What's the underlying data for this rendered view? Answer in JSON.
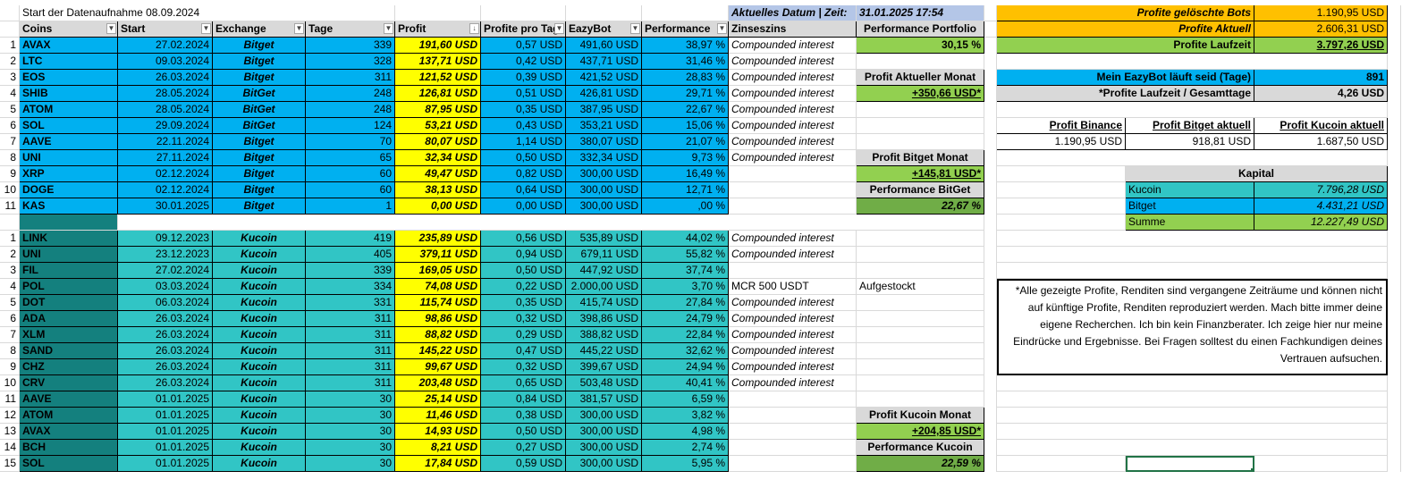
{
  "title_start": "Start der Datenaufnahme 08.09.2024",
  "date": {
    "label": "Aktuelles Datum | Zeit:",
    "value": "31.01.2025 17:54"
  },
  "headers": {
    "coins": "Coins",
    "start": "Start",
    "exchange": "Exchange",
    "tage": "Tage",
    "profit": "Profit",
    "profit_tag": "Profite pro Tag*",
    "eazybot": "EazyBot",
    "performance": "Performance",
    "zinseszins": "Zinseszins"
  },
  "group1": [
    {
      "n": "1",
      "coin": "AVAX",
      "start": "27.02.2024",
      "ex": "Bitget",
      "tage": "339",
      "profit": "191,60 USD",
      "ptag": "0,57 USD",
      "bot": "491,60 USD",
      "perf": "38,97 %",
      "zins": "Compounded interest"
    },
    {
      "n": "2",
      "coin": "LTC",
      "start": "09.03.2024",
      "ex": "Bitget",
      "tage": "328",
      "profit": "137,71 USD",
      "ptag": "0,42 USD",
      "bot": "437,71 USD",
      "perf": "31,46 %",
      "zins": "Compounded interest"
    },
    {
      "n": "3",
      "coin": "EOS",
      "start": "26.03.2024",
      "ex": "Bitget",
      "tage": "311",
      "profit": "121,52 USD",
      "ptag": "0,39 USD",
      "bot": "421,52 USD",
      "perf": "28,83 %",
      "zins": "Compounded interest"
    },
    {
      "n": "4",
      "coin": "SHIB",
      "start": "28.05.2024",
      "ex": "BitGet",
      "tage": "248",
      "profit": "126,81 USD",
      "ptag": "0,51 USD",
      "bot": "426,81 USD",
      "perf": "29,71 %",
      "zins": "Compounded interest"
    },
    {
      "n": "5",
      "coin": "ATOM",
      "start": "28.05.2024",
      "ex": "BitGet",
      "tage": "248",
      "profit": "87,95 USD",
      "ptag": "0,35 USD",
      "bot": "387,95 USD",
      "perf": "22,67 %",
      "zins": "Compounded interest"
    },
    {
      "n": "6",
      "coin": "SOL",
      "start": "29.09.2024",
      "ex": "BitGet",
      "tage": "124",
      "profit": "53,21 USD",
      "ptag": "0,43 USD",
      "bot": "353,21 USD",
      "perf": "15,06 %",
      "zins": "Compounded interest"
    },
    {
      "n": "7",
      "coin": "AAVE",
      "start": "22.11.2024",
      "ex": "Bitget",
      "tage": "70",
      "profit": "80,07 USD",
      "ptag": "1,14 USD",
      "bot": "380,07 USD",
      "perf": "21,07 %",
      "zins": "Compounded interest"
    },
    {
      "n": "8",
      "coin": "UNI",
      "start": "27.11.2024",
      "ex": "Bitget",
      "tage": "65",
      "profit": "32,34 USD",
      "ptag": "0,50 USD",
      "bot": "332,34 USD",
      "perf": "9,73 %",
      "zins": "Compounded interest"
    },
    {
      "n": "9",
      "coin": "XRP",
      "start": "02.12.2024",
      "ex": "Bitget",
      "tage": "60",
      "profit": "49,47 USD",
      "ptag": "0,82 USD",
      "bot": "300,00 USD",
      "perf": "16,49 %",
      "zins": ""
    },
    {
      "n": "10",
      "coin": "DOGE",
      "start": "02.12.2024",
      "ex": "Bitget",
      "tage": "60",
      "profit": "38,13 USD",
      "ptag": "0,64 USD",
      "bot": "300,00 USD",
      "perf": "12,71 %",
      "zins": ""
    },
    {
      "n": "11",
      "coin": "KAS",
      "start": "30.01.2025",
      "ex": "Bitget",
      "tage": "1",
      "profit": "0,00 USD",
      "ptag": "0,00 USD",
      "bot": "300,00 USD",
      "perf": ",00 %",
      "zins": ""
    }
  ],
  "group2": [
    {
      "n": "1",
      "coin": "LINK",
      "start": "09.12.2023",
      "ex": "Kucoin",
      "tage": "419",
      "profit": "235,89 USD",
      "ptag": "0,56 USD",
      "bot": "535,89 USD",
      "perf": "44,02 %",
      "zins": "Compounded interest"
    },
    {
      "n": "2",
      "coin": "UNI",
      "start": "23.12.2023",
      "ex": "Kucoin",
      "tage": "405",
      "profit": "379,11 USD",
      "ptag": "0,94 USD",
      "bot": "679,11 USD",
      "perf": "55,82 %",
      "zins": "Compounded interest"
    },
    {
      "n": "3",
      "coin": "FIL",
      "start": "27.02.2024",
      "ex": "Kucoin",
      "tage": "339",
      "profit": "169,05 USD",
      "ptag": "0,50 USD",
      "bot": "447,92 USD",
      "perf": "37,74 %",
      "zins": ""
    },
    {
      "n": "4",
      "coin": "POL",
      "start": "03.03.2024",
      "ex": "Kucoin",
      "tage": "334",
      "profit": "74,08 USD",
      "ptag": "0,22 USD",
      "bot": "2.000,00 USD",
      "perf": "3,70 %",
      "zins": "MCR 500 USDT"
    },
    {
      "n": "5",
      "coin": "DOT",
      "start": "06.03.2024",
      "ex": "Kucoin",
      "tage": "331",
      "profit": "115,74 USD",
      "ptag": "0,35 USD",
      "bot": "415,74 USD",
      "perf": "27,84 %",
      "zins": "Compounded interest"
    },
    {
      "n": "6",
      "coin": "ADA",
      "start": "26.03.2024",
      "ex": "Kucoin",
      "tage": "311",
      "profit": "98,86 USD",
      "ptag": "0,32 USD",
      "bot": "398,86 USD",
      "perf": "24,79 %",
      "zins": "Compounded interest"
    },
    {
      "n": "7",
      "coin": "XLM",
      "start": "26.03.2024",
      "ex": "Kucoin",
      "tage": "311",
      "profit": "88,82 USD",
      "ptag": "0,29 USD",
      "bot": "388,82 USD",
      "perf": "22,84 %",
      "zins": "Compounded interest"
    },
    {
      "n": "8",
      "coin": "SAND",
      "start": "26.03.2024",
      "ex": "Kucoin",
      "tage": "311",
      "profit": "145,22 USD",
      "ptag": "0,47 USD",
      "bot": "445,22 USD",
      "perf": "32,62 %",
      "zins": "Compounded interest"
    },
    {
      "n": "9",
      "coin": "CHZ",
      "start": "26.03.2024",
      "ex": "Kucoin",
      "tage": "311",
      "profit": "99,67 USD",
      "ptag": "0,32 USD",
      "bot": "399,67 USD",
      "perf": "24,94 %",
      "zins": "Compounded interest"
    },
    {
      "n": "10",
      "coin": "CRV",
      "start": "26.03.2024",
      "ex": "Kucoin",
      "tage": "311",
      "profit": "203,48 USD",
      "ptag": "0,65 USD",
      "bot": "503,48 USD",
      "perf": "40,41 %",
      "zins": "Compounded interest"
    },
    {
      "n": "11",
      "coin": "AAVE",
      "start": "01.01.2025",
      "ex": "Kucoin",
      "tage": "30",
      "profit": "25,14 USD",
      "ptag": "0,84 USD",
      "bot": "381,57 USD",
      "perf": "6,59 %",
      "zins": ""
    },
    {
      "n": "12",
      "coin": "ATOM",
      "start": "01.01.2025",
      "ex": "Kucoin",
      "tage": "30",
      "profit": "11,46 USD",
      "ptag": "0,38 USD",
      "bot": "300,00 USD",
      "perf": "3,82 %",
      "zins": ""
    },
    {
      "n": "13",
      "coin": "AVAX",
      "start": "01.01.2025",
      "ex": "Kucoin",
      "tage": "30",
      "profit": "14,93 USD",
      "ptag": "0,50 USD",
      "bot": "300,00 USD",
      "perf": "4,98 %",
      "zins": ""
    },
    {
      "n": "14",
      "coin": "BCH",
      "start": "01.01.2025",
      "ex": "Kucoin",
      "tage": "30",
      "profit": "8,21 USD",
      "ptag": "0,27 USD",
      "bot": "300,00 USD",
      "perf": "2,74 %",
      "zins": ""
    },
    {
      "n": "15",
      "coin": "SOL",
      "start": "01.01.2025",
      "ex": "Kucoin",
      "tage": "30",
      "profit": "17,84 USD",
      "ptag": "0,59 USD",
      "bot": "300,00 USD",
      "perf": "5,95 %",
      "zins": ""
    }
  ],
  "side": {
    "perf_portfolio_label": "Performance Portfolio",
    "perf_portfolio_value": "30,15 %",
    "profit_monat_label": "Profit Aktueller Monat",
    "profit_monat_value": "+350,66 USD*",
    "bitget_monat_label": "Profit Bitget Monat",
    "bitget_monat_value": "+145,81 USD*",
    "perf_bitget_label": "Performance BitGet",
    "perf_bitget_value": "22,67 %",
    "aufgestockt": "Aufgestockt",
    "kucoin_monat_label": "Profit Kucoin Monat",
    "kucoin_monat_value": "+204,85 USD*",
    "perf_kucoin_label": "Performance Kucoin",
    "perf_kucoin_value": "22,59 %"
  },
  "summary": {
    "geloescht_label": "Profite gelöschte Bots",
    "geloescht_value": "1.190,95 USD",
    "aktuell_label": "Profite Aktuell",
    "aktuell_value": "2.606,31 USD",
    "laufzeit_label": "Profite Laufzeit",
    "laufzeit_value": "3.797,26 USD",
    "eazybot_tage_label": "Mein EazyBot läuft seid (Tage)",
    "eazybot_tage_value": "891",
    "laufzeit_tage_label": "*Profite Laufzeit  / Gesamttage",
    "laufzeit_tage_value": "4,26 USD",
    "binance_label": "Profit Binance",
    "binance_value": "1.190,95 USD",
    "bitget_label": "Profit Bitget aktuell",
    "bitget_value": "918,81 USD",
    "kucoin_label": "Profit Kucoin aktuell",
    "kucoin_value": "1.687,50 USD",
    "kapital_label": "Kapital",
    "kap_kucoin_label": "Kucoin",
    "kap_kucoin_value": "7.796,28 USD",
    "kap_bitget_label": "Bitget",
    "kap_bitget_value": "4.431,21 USD",
    "kap_summe_label": "Summe",
    "kap_summe_value": "12.227,49 USD"
  },
  "disclaimer": "*Alle gezeigte Profite, Renditen sind vergangene Zeiträume und können nicht auf künftige Profite, Renditen reproduziert werden. Mach bitte immer deine eigene Recherchen. Ich bin kein Finanzberater. Ich zeige hier nur meine Eindrücke und Ergebnisse. Bei Fragen solltest du einen Fachkundigen deines Vertrauen aufsuchen.",
  "colors": {
    "bitget_coin": "#00b0f0",
    "kucoin_coin": "#14807e",
    "kucoin_row": "#31c5c5",
    "profit": "#ffff00",
    "green": "#92d050",
    "orange": "#ffc000"
  }
}
